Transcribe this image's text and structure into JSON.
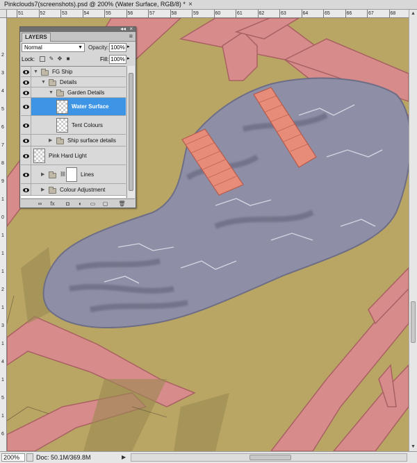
{
  "document": {
    "tab_title": "Pinkclouds7(screenshots).psd @ 200% (Water Surface, RGB/8) *",
    "close_glyph": "×"
  },
  "rulers": {
    "horizontal": [
      "51",
      "52",
      "53",
      "54",
      "55",
      "56",
      "57",
      "58",
      "59",
      "60",
      "61",
      "62",
      "63",
      "64",
      "65",
      "66",
      "67",
      "68"
    ],
    "vertical": [
      "2",
      "3",
      "4",
      "5",
      "6",
      "7",
      "8",
      "9",
      "1",
      "0",
      "1",
      "1",
      "1",
      "2",
      "1",
      "3",
      "1",
      "4",
      "1",
      "5",
      "1",
      "6"
    ]
  },
  "layers_panel": {
    "tab_label": "LAYERS",
    "collapse_glyph": "◂◂",
    "close_glyph": "×",
    "menu_glyph": "≡",
    "blend_mode": "Normal",
    "opacity_label": "Opacity:",
    "opacity_value": "100%",
    "lock_label": "Lock:",
    "fill_label": "Fill:",
    "fill_value": "100%",
    "layers": [
      {
        "name": "FG Ship",
        "type": "group",
        "expanded": true,
        "visible": true,
        "indent": 0
      },
      {
        "name": "Details",
        "type": "group",
        "expanded": true,
        "visible": true,
        "indent": 1
      },
      {
        "name": "Garden Details",
        "type": "group",
        "expanded": true,
        "visible": true,
        "indent": 2
      },
      {
        "name": "Water Surface",
        "type": "layer",
        "selected": true,
        "visible": true,
        "indent": 3
      },
      {
        "name": "Tent Colours",
        "type": "layer",
        "visible": true,
        "indent": 3
      },
      {
        "name": "Ship surface details",
        "type": "group",
        "expanded": false,
        "visible": true,
        "indent": 2
      },
      {
        "name": "Pink Hard Light",
        "type": "layer",
        "visible": true,
        "indent": 0
      },
      {
        "name": "Lines",
        "type": "group-mask",
        "expanded": false,
        "visible": true,
        "indent": 1
      },
      {
        "name": "Colour Adjustment",
        "type": "group",
        "expanded": false,
        "visible": true,
        "indent": 1
      }
    ],
    "footer_icons": [
      "link-icon",
      "fx-icon",
      "mask-icon",
      "adjustment-icon",
      "folder-icon",
      "new-layer-icon",
      "trash-icon"
    ],
    "footer_glyphs": [
      "∞",
      "fx",
      "◘",
      "◐",
      "▭",
      "▢",
      "🗑"
    ]
  },
  "status_bar": {
    "zoom": "200%",
    "doc_info": "Doc: 50.1M/369.8M",
    "arrow_glyph": "▶"
  },
  "colors": {
    "canvas_olive": "#b9a564",
    "pink": "#d98a8e",
    "water": "#8e8fa6",
    "selection_blue": "#3e95e6"
  }
}
